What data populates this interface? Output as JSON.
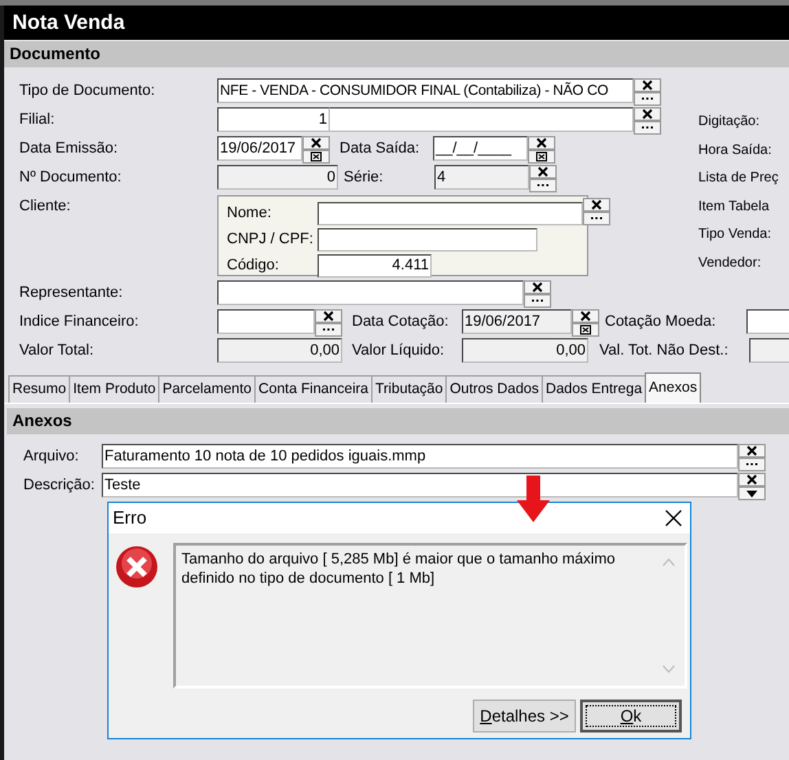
{
  "window": {
    "title": "Nota Venda"
  },
  "document_section": {
    "title": "Documento"
  },
  "tipo_documento": {
    "label": "Tipo de Documento:",
    "value": "NFE - VENDA - CONSUMIDOR FINAL  (Contabiliza) - NÃO CO",
    "disabled": false
  },
  "filial": {
    "label": "Filial:",
    "value": "1",
    "disabled": false
  },
  "data_emissao": {
    "label": "Data Emissão:",
    "value": "19/06/2017",
    "disabled": false
  },
  "data_saida": {
    "label": "Data Saída:",
    "value": "__/__/____",
    "disabled": false
  },
  "numero_documento": {
    "label": "Nº Documento:",
    "value": "0",
    "disabled": true
  },
  "serie": {
    "label": "Série:",
    "value": "4",
    "disabled": true
  },
  "cliente": {
    "label": "Cliente:",
    "nome": {
      "label": "Nome:",
      "disabled": false
    },
    "cnpj_cpf": {
      "label": "CNPJ / CPF:",
      "disabled": false
    },
    "codigo": {
      "label": "Código:",
      "value": "4.411",
      "disabled": false
    }
  },
  "right_labels": [
    "Digitação:",
    "Hora Saída:",
    "Lista de Preç",
    "Item Tabela",
    "Tipo Venda:",
    "Vendedor:"
  ],
  "representante": {
    "label": "Representante:",
    "disabled": false
  },
  "indice_financeiro": {
    "label": "Indice Financeiro:",
    "disabled": false
  },
  "data_cotacao": {
    "label": "Data Cotação:",
    "value": "19/06/2017",
    "disabled": true
  },
  "cotacao_moeda": {
    "label": "Cotação Moeda:",
    "disabled": false
  },
  "valor_total": {
    "label": "Valor Total:",
    "value": "0,00",
    "disabled": true
  },
  "valor_liquido": {
    "label": "Valor Líquido:",
    "value": "0,00",
    "disabled": true
  },
  "val_tot_nao_dest": {
    "label": "Val. Tot. Não Dest.:",
    "disabled": true
  },
  "tabs": [
    {
      "label": "Resumo",
      "selected": false
    },
    {
      "label": "Item Produto",
      "selected": false
    },
    {
      "label": "Parcelamento",
      "selected": false
    },
    {
      "label": "Conta Financeira",
      "selected": false
    },
    {
      "label": "Tributação",
      "selected": false
    },
    {
      "label": "Outros Dados",
      "selected": false
    },
    {
      "label": "Dados Entrega",
      "selected": false
    },
    {
      "label": "Anexos",
      "selected": true
    }
  ],
  "anexos": {
    "title": "Anexos",
    "arquivo": {
      "label": "Arquivo:",
      "value": "Faturamento 10 nota de 10 pedidos iguais.mmp",
      "disabled": false
    },
    "descricao": {
      "label": "Descrição:",
      "value": "Teste",
      "disabled": false
    }
  },
  "dialog": {
    "title": "Erro",
    "message": "Tamanho do arquivo [ 5,285 Mb] é maior que o tamanho máximo definido no tipo de documento [ 1 Mb]",
    "buttons": [
      {
        "label": "Detalhes >>",
        "default": false
      },
      {
        "label": "Ok",
        "default": true
      }
    ]
  }
}
